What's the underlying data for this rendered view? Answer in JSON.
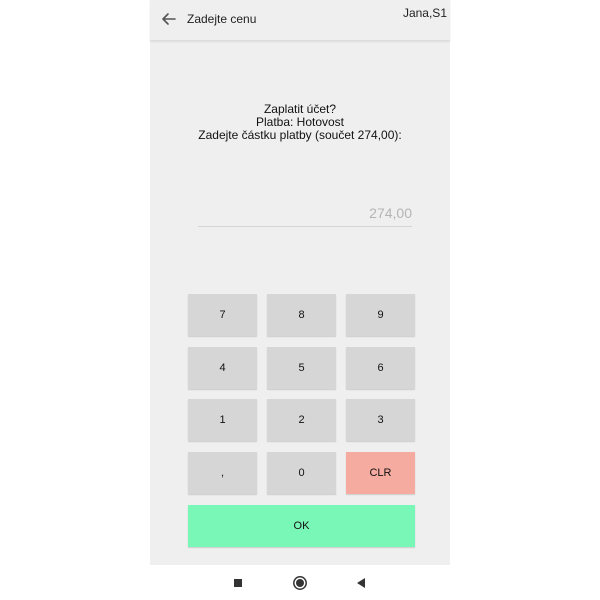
{
  "appbar": {
    "title": "Zadejte cenu",
    "user": "Jana,S1",
    "back_icon": "arrow-left-icon"
  },
  "prompt": {
    "line1": "Zaplatit účet?",
    "line2": "Platba: Hotovost",
    "line3": "Zadejte částku platby (součet 274,00):"
  },
  "amount": {
    "value": "",
    "placeholder": "274,00"
  },
  "keypad": {
    "keys": [
      "7",
      "8",
      "9",
      "4",
      "5",
      "6",
      "1",
      "2",
      "3",
      ",",
      "0",
      "CLR"
    ],
    "ok_label": "OK"
  },
  "colors": {
    "background": "#efefef",
    "key": "#d6d6d6",
    "clear_key": "#f6aba0",
    "ok_key": "#79f7b6"
  },
  "navbar": {
    "icons": [
      "recent-apps-icon",
      "home-icon",
      "back-triangle-icon"
    ]
  }
}
